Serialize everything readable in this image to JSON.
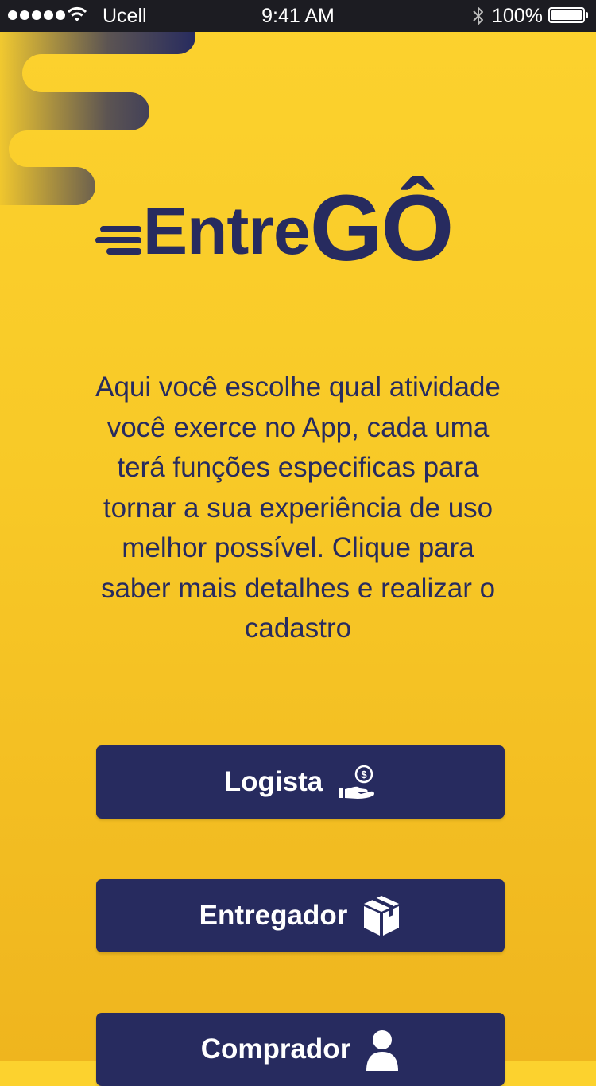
{
  "status_bar": {
    "carrier": "Ucell",
    "time": "9:41 AM",
    "battery_percent": "100%",
    "signal_dots": 5
  },
  "brand": {
    "name_part1": "Entre",
    "name_part2": "GÔ",
    "primary_color": "#272B5F",
    "background_color": "#FCD22E"
  },
  "intro": {
    "text_lines": [
      "Aqui você escolhe qual atividade",
      "você exerce no App, cada uma",
      "terá funções especificas para",
      "tornar a sua experiência de uso",
      "melhor possível. Clique para",
      "saber mais detalhes e realizar o",
      "cadastro"
    ]
  },
  "roles": [
    {
      "label": "Logista",
      "icon": "hand-money-icon"
    },
    {
      "label": "Entregador",
      "icon": "package-box-icon"
    },
    {
      "label": "Comprador",
      "icon": "user-icon"
    }
  ]
}
